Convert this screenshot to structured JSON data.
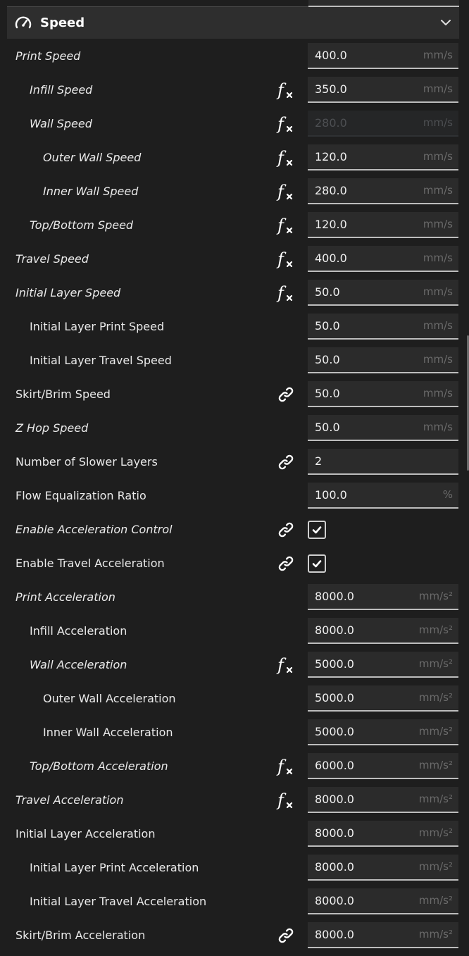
{
  "section": {
    "title": "Speed",
    "icon": "speedometer-icon",
    "collapse_icon": "chevron-down-icon"
  },
  "rows": [
    {
      "label": "Print Speed",
      "level": 0,
      "italic": true,
      "icon": "",
      "value": "400.0",
      "unit": "mm/s",
      "disabled": false
    },
    {
      "label": "Infill Speed",
      "level": 1,
      "italic": true,
      "icon": "fx",
      "value": "350.0",
      "unit": "mm/s",
      "disabled": false
    },
    {
      "label": "Wall Speed",
      "level": 1,
      "italic": true,
      "icon": "fx",
      "value": "280.0",
      "unit": "mm/s",
      "disabled": true
    },
    {
      "label": "Outer Wall Speed",
      "level": 2,
      "italic": true,
      "icon": "fx",
      "value": "120.0",
      "unit": "mm/s",
      "disabled": false
    },
    {
      "label": "Inner Wall Speed",
      "level": 2,
      "italic": true,
      "icon": "fx",
      "value": "280.0",
      "unit": "mm/s",
      "disabled": false
    },
    {
      "label": "Top/Bottom Speed",
      "level": 1,
      "italic": true,
      "icon": "fx",
      "value": "120.0",
      "unit": "mm/s",
      "disabled": false
    },
    {
      "label": "Travel Speed",
      "level": 0,
      "italic": true,
      "icon": "fx",
      "value": "400.0",
      "unit": "mm/s",
      "disabled": false
    },
    {
      "label": "Initial Layer Speed",
      "level": 0,
      "italic": true,
      "icon": "fx",
      "value": "50.0",
      "unit": "mm/s",
      "disabled": false
    },
    {
      "label": "Initial Layer Print Speed",
      "level": 1,
      "italic": false,
      "icon": "",
      "value": "50.0",
      "unit": "mm/s",
      "disabled": false
    },
    {
      "label": "Initial Layer Travel Speed",
      "level": 1,
      "italic": false,
      "icon": "",
      "value": "50.0",
      "unit": "mm/s",
      "disabled": false
    },
    {
      "label": "Skirt/Brim Speed",
      "level": 0,
      "italic": false,
      "icon": "link",
      "value": "50.0",
      "unit": "mm/s",
      "disabled": false
    },
    {
      "label": "Z Hop Speed",
      "level": 0,
      "italic": true,
      "icon": "",
      "value": "50.0",
      "unit": "mm/s",
      "disabled": false
    },
    {
      "label": "Number of Slower Layers",
      "level": 0,
      "italic": false,
      "icon": "link",
      "value": "2",
      "unit": "",
      "disabled": false
    },
    {
      "label": "Flow Equalization Ratio",
      "level": 0,
      "italic": false,
      "icon": "",
      "value": "100.0",
      "unit": "%",
      "disabled": false
    },
    {
      "label": "Enable Acceleration Control",
      "level": 0,
      "italic": true,
      "icon": "link",
      "type": "checkbox",
      "checked": true
    },
    {
      "label": "Enable Travel Acceleration",
      "level": 0,
      "italic": false,
      "icon": "link",
      "type": "checkbox",
      "checked": true
    },
    {
      "label": "Print Acceleration",
      "level": 0,
      "italic": true,
      "icon": "",
      "value": "8000.0",
      "unit": "mm/s²",
      "disabled": false
    },
    {
      "label": "Infill Acceleration",
      "level": 1,
      "italic": false,
      "icon": "",
      "value": "8000.0",
      "unit": "mm/s²",
      "disabled": false
    },
    {
      "label": "Wall Acceleration",
      "level": 1,
      "italic": true,
      "icon": "fx",
      "value": "5000.0",
      "unit": "mm/s²",
      "disabled": false
    },
    {
      "label": "Outer Wall Acceleration",
      "level": 2,
      "italic": false,
      "icon": "",
      "value": "5000.0",
      "unit": "mm/s²",
      "disabled": false
    },
    {
      "label": "Inner Wall Acceleration",
      "level": 2,
      "italic": false,
      "icon": "",
      "value": "5000.0",
      "unit": "mm/s²",
      "disabled": false
    },
    {
      "label": "Top/Bottom Acceleration",
      "level": 1,
      "italic": true,
      "icon": "fx",
      "value": "6000.0",
      "unit": "mm/s²",
      "disabled": false
    },
    {
      "label": "Travel Acceleration",
      "level": 0,
      "italic": true,
      "icon": "fx",
      "value": "8000.0",
      "unit": "mm/s²",
      "disabled": false
    },
    {
      "label": "Initial Layer Acceleration",
      "level": 0,
      "italic": false,
      "icon": "",
      "value": "8000.0",
      "unit": "mm/s²",
      "disabled": false
    },
    {
      "label": "Initial Layer Print Acceleration",
      "level": 1,
      "italic": false,
      "icon": "",
      "value": "8000.0",
      "unit": "mm/s²",
      "disabled": false
    },
    {
      "label": "Initial Layer Travel Acceleration",
      "level": 1,
      "italic": false,
      "icon": "",
      "value": "8000.0",
      "unit": "mm/s²",
      "disabled": false
    },
    {
      "label": "Skirt/Brim Acceleration",
      "level": 0,
      "italic": false,
      "icon": "link",
      "value": "8000.0",
      "unit": "mm/s²",
      "disabled": false
    }
  ]
}
